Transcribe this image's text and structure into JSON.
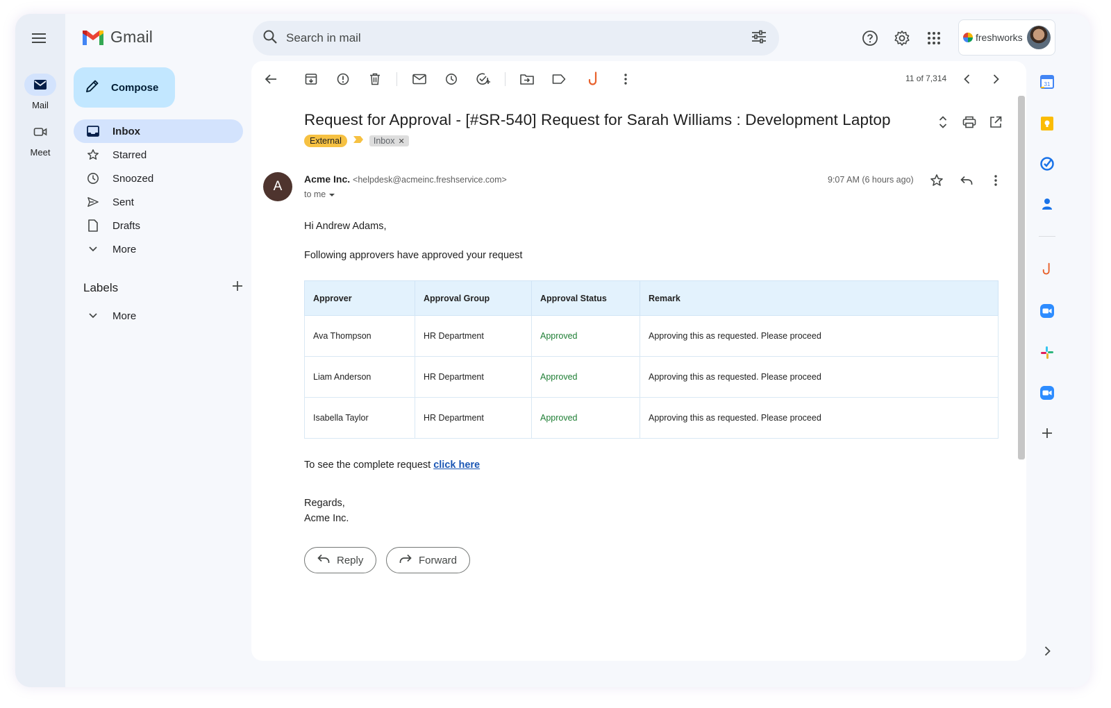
{
  "rail": {
    "items": [
      {
        "label": "Mail"
      },
      {
        "label": "Meet"
      }
    ]
  },
  "app": {
    "name": "Gmail"
  },
  "search": {
    "placeholder": "Search in mail"
  },
  "account": {
    "org": "freshworks"
  },
  "sidebar": {
    "compose_label": "Compose",
    "items": [
      {
        "label": "Inbox"
      },
      {
        "label": "Starred"
      },
      {
        "label": "Snoozed"
      },
      {
        "label": "Sent"
      },
      {
        "label": "Drafts"
      },
      {
        "label": "More"
      }
    ],
    "labels_title": "Labels",
    "labels_more": "More"
  },
  "toolbar": {
    "pager": "11 of 7,314"
  },
  "email": {
    "subject": "Request for Approval - [#SR-540] Request for Sarah Williams : Development Laptop",
    "chip_external": "External",
    "chip_inbox": "Inbox",
    "sender_initial": "A",
    "sender_name": "Acme Inc.",
    "sender_email": "<helpdesk@acmeinc.freshservice.com>",
    "to_me": "to me",
    "time": "9:07 AM (6 hours ago)",
    "greeting": "Hi Andrew Adams,",
    "intro": "Following approvers have approved your request",
    "table": {
      "headers": [
        "Approver",
        "Approval Group",
        "Approval Status",
        "Remark"
      ],
      "rows": [
        [
          "Ava Thompson",
          "HR Department",
          "Approved",
          "Approving this as requested. Please proceed"
        ],
        [
          "Liam Anderson",
          "HR Department",
          "Approved",
          "Approving this as requested. Please proceed"
        ],
        [
          "Isabella Taylor",
          "HR Department",
          "Approved",
          "Approving this as requested. Please proceed"
        ]
      ]
    },
    "see_request_text": "To see the complete request ",
    "see_request_link": "click here",
    "regards": "Regards,",
    "signature": "Acme Inc.",
    "reply_label": "Reply",
    "forward_label": "Forward"
  },
  "colors": {
    "accent": "#d3e3fd",
    "compose_bg": "#c2e7ff",
    "chip_external": "#f6c142",
    "approved_text": "#1e7e34",
    "table_header": "#e3f2fd",
    "link": "#1a56b4"
  }
}
